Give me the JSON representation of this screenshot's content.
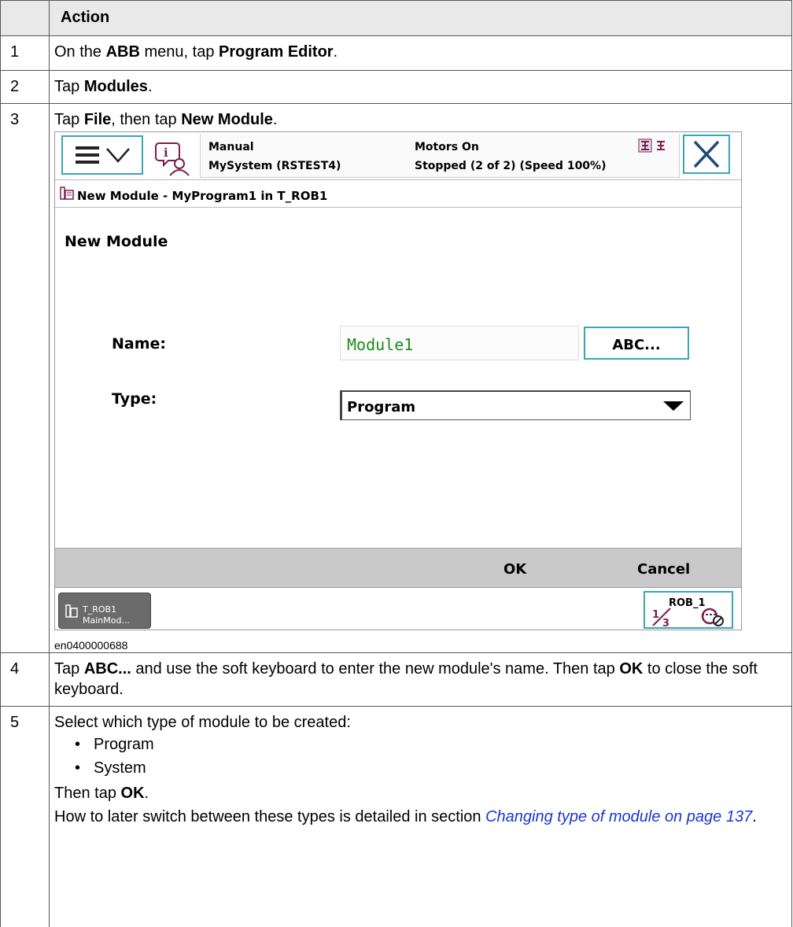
{
  "table": {
    "header_num": "",
    "header_action": "Action"
  },
  "steps": [
    {
      "num": "1",
      "parts": [
        "On the ",
        "ABB",
        " menu, tap ",
        "Program Editor",
        "."
      ]
    },
    {
      "num": "2",
      "parts": [
        "Tap ",
        "Modules",
        "."
      ]
    },
    {
      "num": "3",
      "parts": [
        "Tap ",
        "File",
        ", then tap ",
        "New Module",
        "."
      ]
    },
    {
      "num": "4",
      "parts": [
        "Tap ",
        "ABC...",
        " and use the soft keyboard to enter the new module's name. Then tap ",
        "OK",
        " to close the soft keyboard."
      ]
    },
    {
      "num": "5",
      "intro": "Select which type of module to be created:",
      "bullets": [
        "Program",
        "System"
      ],
      "then_parts": [
        "Then tap ",
        "OK",
        "."
      ],
      "more_text": "How to later switch between these types is detailed in section ",
      "link_text": "Changing type of module on page 137",
      "end_period": "."
    }
  ],
  "screenshot": {
    "status": {
      "mode": "Manual",
      "system": "MySystem (RSTEST4)",
      "motors": "Motors On",
      "state": "Stopped (2 of 2) (Speed 100%)"
    },
    "window_title": "New Module - MyProgram1 in T_ROB1",
    "form_title": "New Module",
    "name_label": "Name:",
    "name_value": "Module1",
    "abc_button": "ABC...",
    "type_label": "Type:",
    "type_value": "Program",
    "ok_button": "OK",
    "cancel_button": "Cancel",
    "task_line1": "T_ROB1",
    "task_line2": "MainMod...",
    "rob_label": "ROB_1",
    "rob_fraction": "1/3",
    "caption": "en0400000688"
  },
  "colors": {
    "accent": "#3aa5b8",
    "name_value": "#1e8c1e",
    "link": "#1a36d6",
    "command_bar": "#c9c9c9"
  }
}
